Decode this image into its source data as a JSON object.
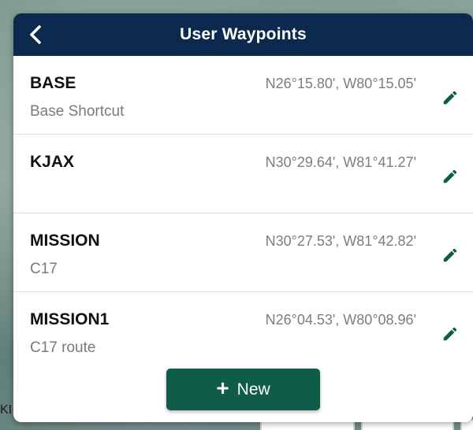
{
  "header": {
    "title": "User Waypoints",
    "back_icon": "chevron-left-icon"
  },
  "waypoints": [
    {
      "name": "BASE",
      "coords": "N26°15.80', W80°15.05'",
      "description": "Base Shortcut"
    },
    {
      "name": "KJAX",
      "coords": "N30°29.64', W81°41.27'",
      "description": ""
    },
    {
      "name": "MISSION",
      "coords": "N30°27.53', W81°42.82'",
      "description": "C17"
    },
    {
      "name": "MISSION1",
      "coords": "N26°04.53', W80°08.96'",
      "description": "C17 route"
    }
  ],
  "new_button": {
    "icon": "+",
    "label": "New"
  },
  "background": {
    "partial_text": "KI"
  },
  "colors": {
    "header": "#0b2a4d",
    "accent_green": "#0f5c48",
    "edit_icon": "#0f5c48"
  }
}
